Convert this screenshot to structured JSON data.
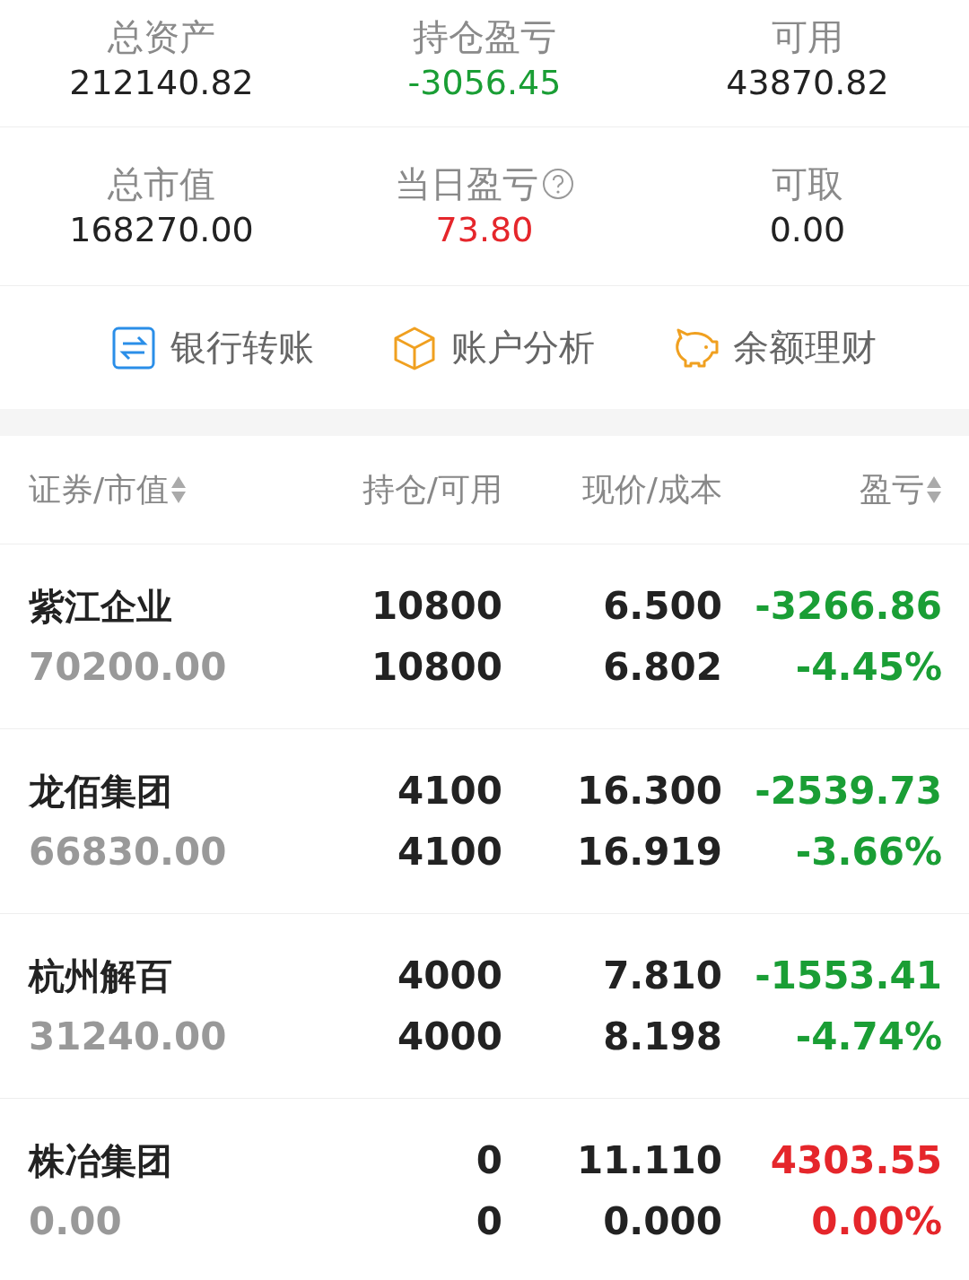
{
  "summary": [
    {
      "label": "总资产",
      "value": "212140.82",
      "color": "#222222",
      "help": false
    },
    {
      "label": "持仓盈亏",
      "value": "-3056.45",
      "color": "#1a9e35",
      "help": false
    },
    {
      "label": "可用",
      "value": "43870.82",
      "color": "#222222",
      "help": false
    },
    {
      "label": "总市值",
      "value": "168270.00",
      "color": "#222222",
      "help": false
    },
    {
      "label": "当日盈亏",
      "value": "73.80",
      "color": "#e5262b",
      "help": true
    },
    {
      "label": "可取",
      "value": "0.00",
      "color": "#222222",
      "help": false
    }
  ],
  "actions": [
    {
      "label": "银行转账",
      "kind": "transfer"
    },
    {
      "label": "账户分析",
      "kind": "cube"
    },
    {
      "label": "余额理财",
      "kind": "piggy"
    }
  ],
  "columns": [
    {
      "label": "证券/市值",
      "sortable": true
    },
    {
      "label": "持仓/可用",
      "sortable": false
    },
    {
      "label": "现价/成本",
      "sortable": false
    },
    {
      "label": "盈亏",
      "sortable": true
    }
  ],
  "rows": [
    {
      "name": "紫江企业",
      "market_value": "70200.00",
      "holding": "10800",
      "available": "10800",
      "price": "6.500",
      "cost": "6.802",
      "pnl": "-3266.86",
      "pnl_pct": "-4.45%",
      "color": "#1a9e35"
    },
    {
      "name": "龙佰集团",
      "market_value": "66830.00",
      "holding": "4100",
      "available": "4100",
      "price": "16.300",
      "cost": "16.919",
      "pnl": "-2539.73",
      "pnl_pct": "-3.66%",
      "color": "#1a9e35"
    },
    {
      "name": "杭州解百",
      "market_value": "31240.00",
      "holding": "4000",
      "available": "4000",
      "price": "7.810",
      "cost": "8.198",
      "pnl": "-1553.41",
      "pnl_pct": "-4.74%",
      "color": "#1a9e35"
    },
    {
      "name": "株冶集团",
      "market_value": "0.00",
      "holding": "0",
      "available": "0",
      "price": "11.110",
      "cost": "0.000",
      "pnl": "4303.55",
      "pnl_pct": "0.00%",
      "color": "#e5262b"
    }
  ]
}
